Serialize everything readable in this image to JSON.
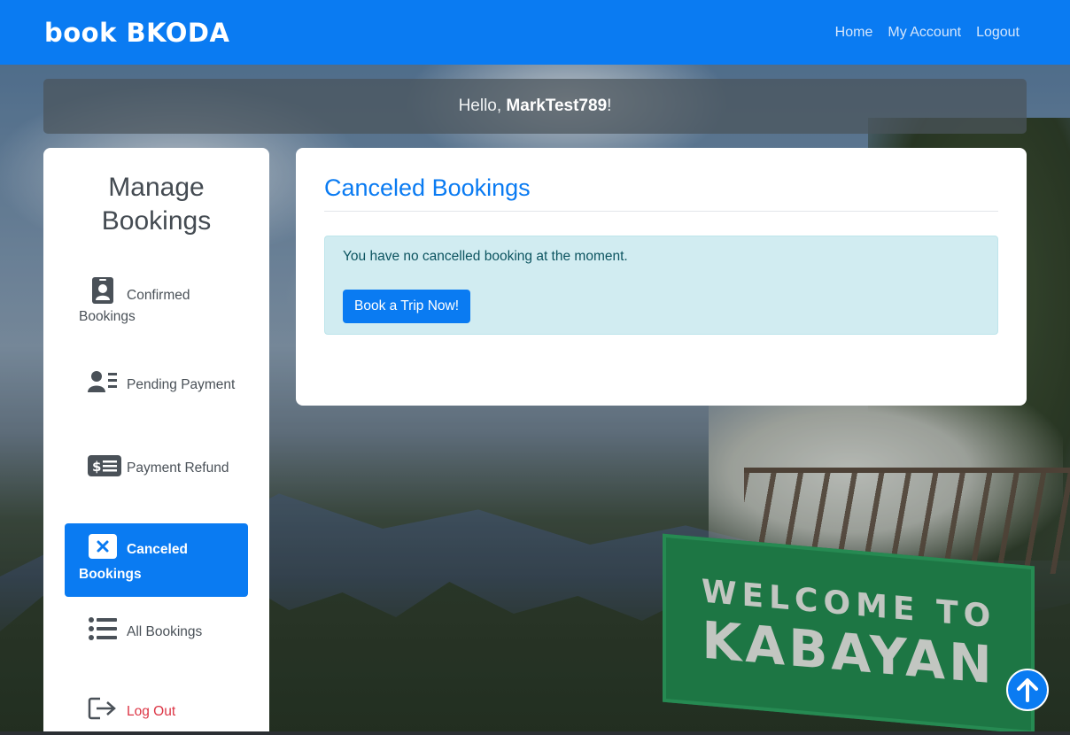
{
  "navbar": {
    "brand": "book BKODA",
    "links": [
      "Home",
      "My Account",
      "Logout"
    ]
  },
  "greeting": {
    "prefix": "Hello, ",
    "username": "MarkTest789",
    "suffix": "!"
  },
  "sidebar": {
    "title": "Manage Bookings",
    "items": [
      {
        "label": "Confirmed Bookings",
        "icon": "id-badge-icon"
      },
      {
        "label": "Pending Payment",
        "icon": "user-list-icon"
      },
      {
        "label": "Payment Refund",
        "icon": "money-bill-icon"
      },
      {
        "label": "Canceled Bookings",
        "icon": "close-box-icon",
        "active": true
      },
      {
        "label": "All Bookings",
        "icon": "list-icon"
      },
      {
        "label": "Log Out",
        "icon": "sign-out-icon"
      }
    ]
  },
  "main": {
    "title": "Canceled Bookings",
    "alert_text": "You have no cancelled booking at the moment.",
    "button_label": "Book a Trip Now!"
  },
  "background": {
    "sign_line1": "WELCOME TO",
    "sign_line2": "KABAYAN"
  },
  "colors": {
    "primary": "#0a7bf2",
    "alert_bg": "#d1ecf1",
    "alert_text": "#0c5460",
    "logout": "#dc3545"
  }
}
